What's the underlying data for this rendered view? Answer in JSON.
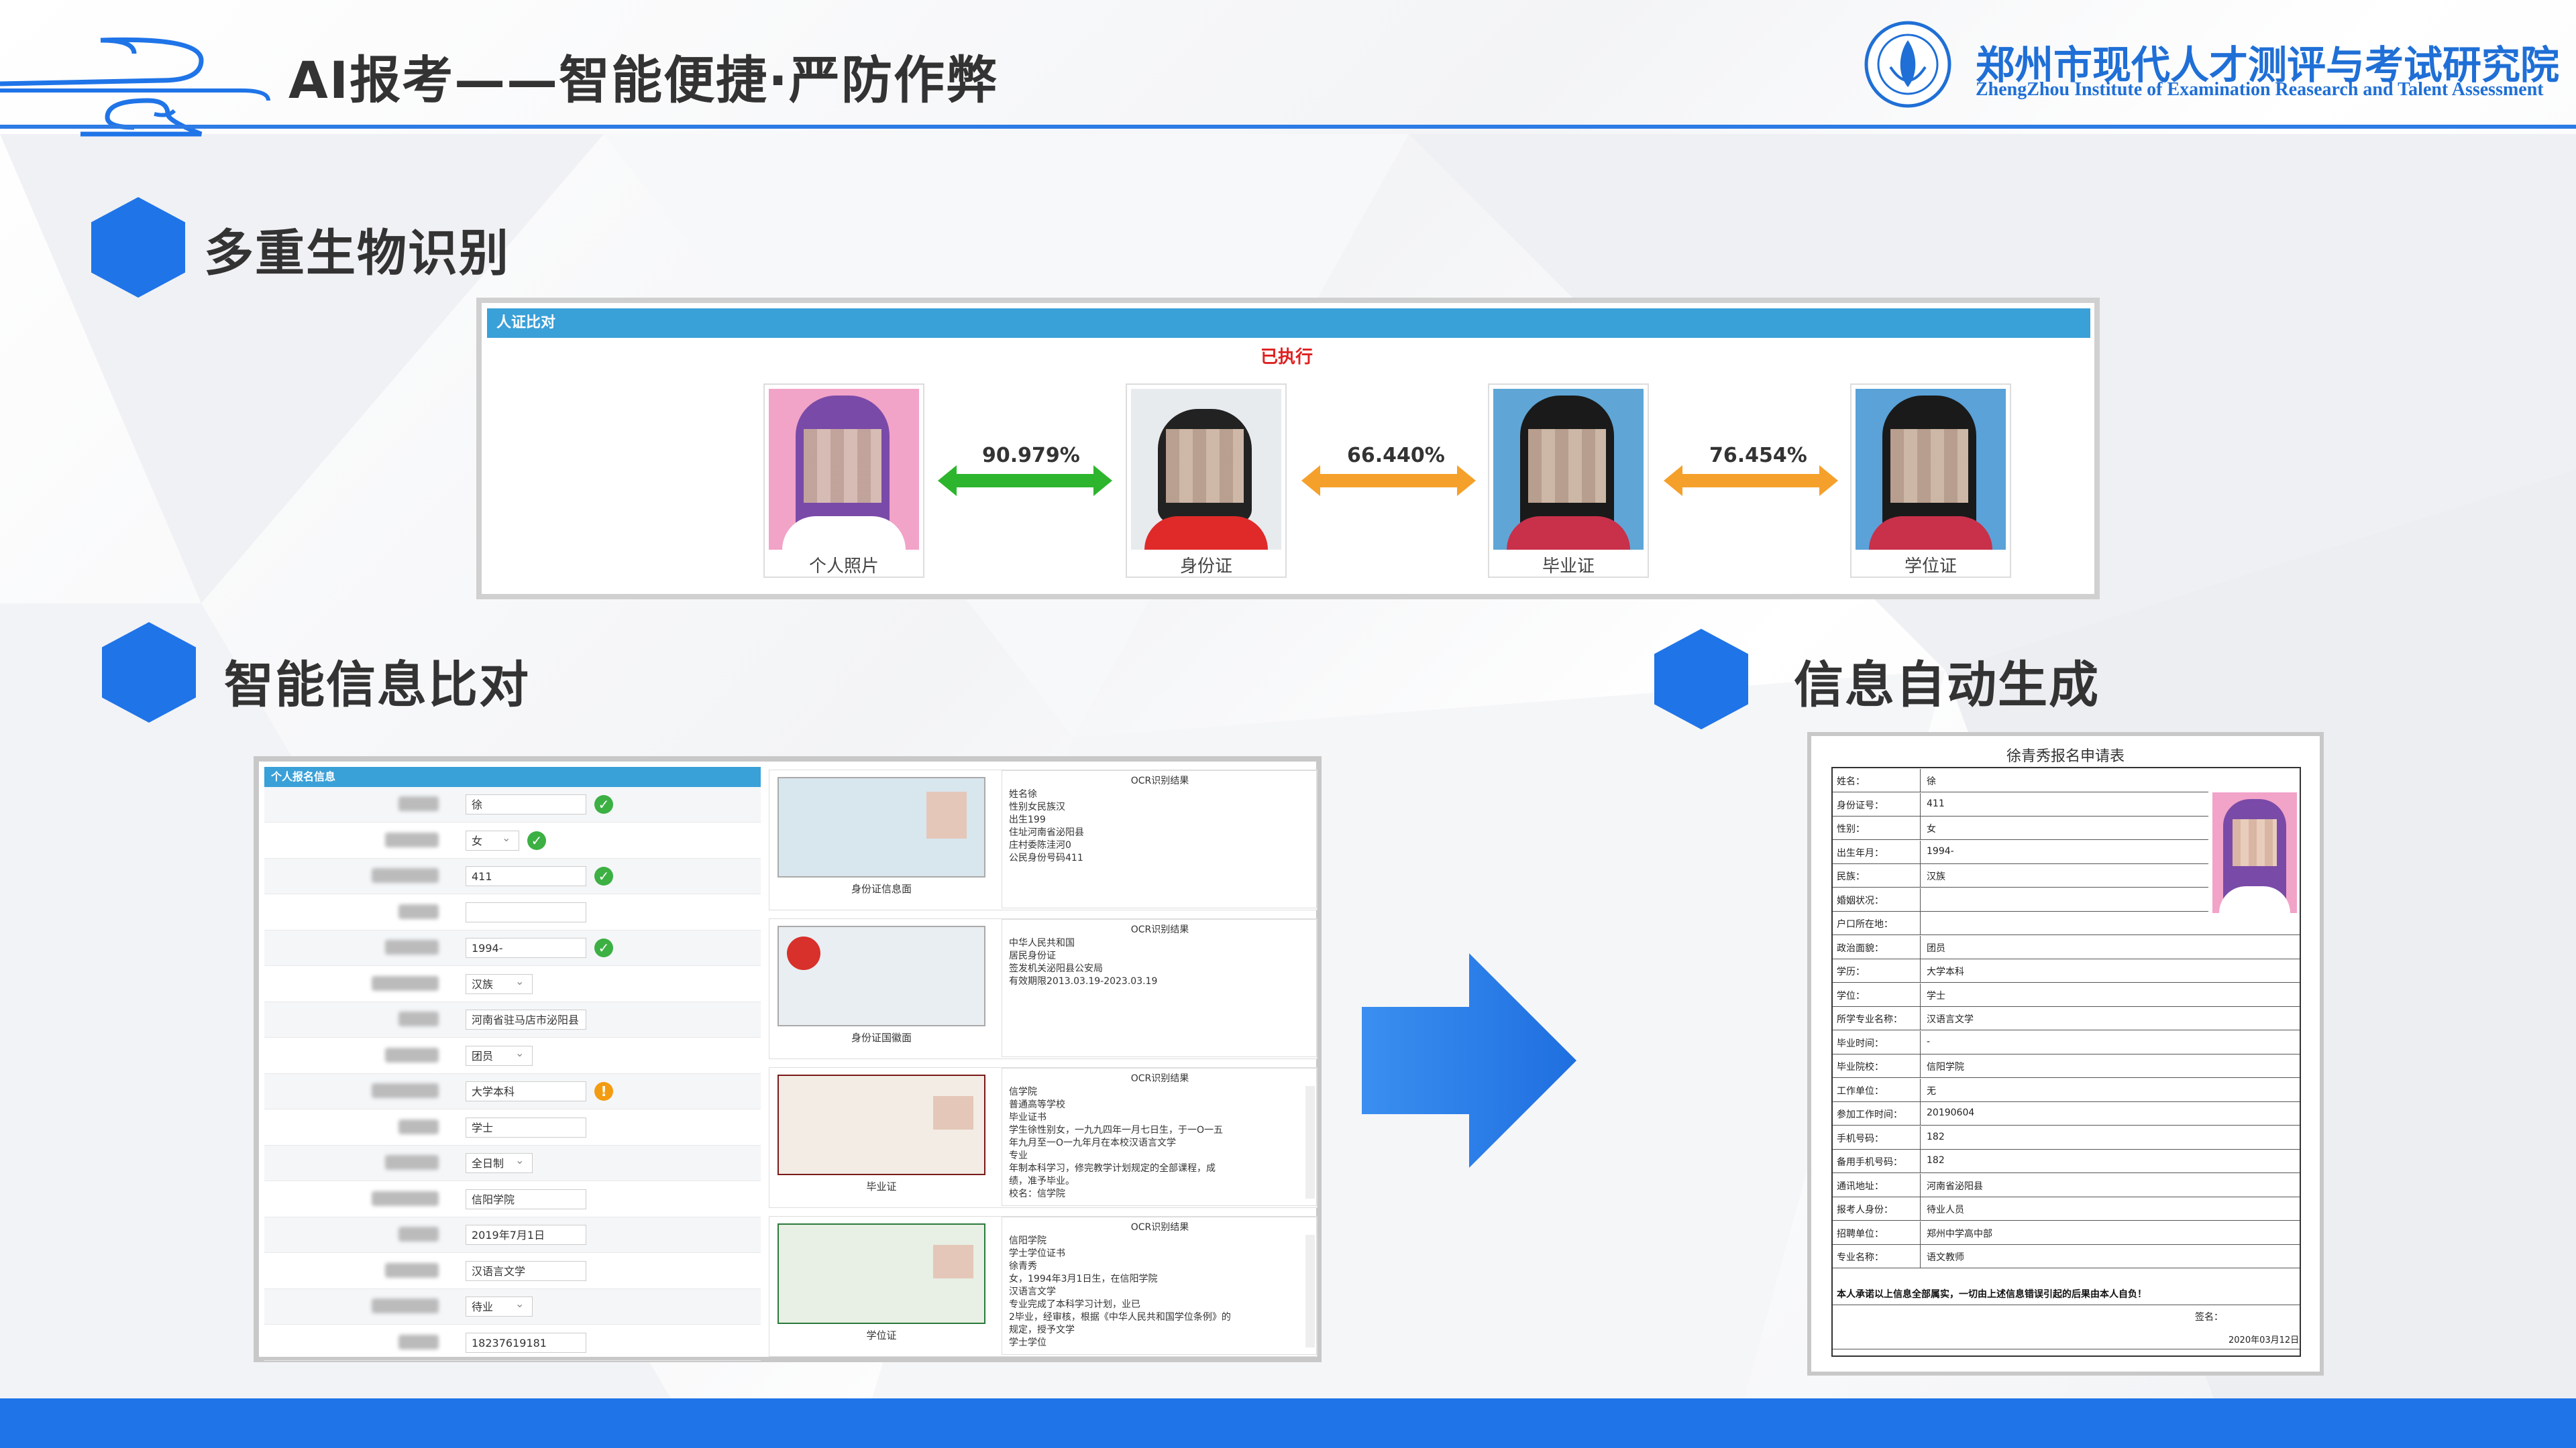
{
  "header": {
    "title": "AI报考——智能便捷·严防作弊",
    "org_cn": "郑州市现代人才测评与考试研究院",
    "org_en": "ZhengZhou Institute of Examination Reasearch and Talent Assessment"
  },
  "sections": {
    "biometric": "多重生物识别",
    "info_compare": "智能信息比对",
    "auto_generate": "信息自动生成"
  },
  "face_compare": {
    "panel_title": "人证比对",
    "status": "已执行",
    "photos": [
      {
        "caption": "个人照片"
      },
      {
        "caption": "身份证"
      },
      {
        "caption": "毕业证"
      },
      {
        "caption": "学位证"
      }
    ],
    "scores": [
      "90.979%",
      "66.440%",
      "76.454%"
    ],
    "arrow_colors": [
      "#2db52d",
      "#f5a02a",
      "#f5a02a"
    ]
  },
  "registration": {
    "panel_title": "个人报名信息",
    "fields": [
      {
        "value": "徐",
        "status": "ok"
      },
      {
        "value": "女",
        "status": "ok",
        "select": true
      },
      {
        "value": "411",
        "status": "ok"
      },
      {
        "value": "",
        "status": ""
      },
      {
        "value": "1994-",
        "status": "ok"
      },
      {
        "value": "汉族",
        "status": "",
        "select": true
      },
      {
        "value": "河南省驻马店市泌阳县",
        "status": ""
      },
      {
        "value": "团员",
        "status": "",
        "select": true
      },
      {
        "value": "大学本科",
        "status": "warn"
      },
      {
        "value": "学士",
        "status": ""
      },
      {
        "value": "全日制",
        "status": "",
        "select": true
      },
      {
        "value": "信阳学院",
        "status": ""
      },
      {
        "value": "2019年7月1日",
        "status": ""
      },
      {
        "value": "汉语言文学",
        "status": ""
      },
      {
        "value": "待业",
        "status": "",
        "select": true
      },
      {
        "value": "18237619181",
        "status": ""
      }
    ],
    "documents": [
      {
        "caption": "身份证信息面",
        "ocr_header": "OCR识别结果",
        "ocr_text": "姓名徐\n性别女民族汉\n出生199\n住址河南省泌阳县\n庄村委陈洼河0\n公民身份号码411"
      },
      {
        "caption": "身份证国徽面",
        "ocr_header": "OCR识别结果",
        "ocr_text": "中华人民共和国\n居民身份证\n签发机关泌阳县公安局\n有效期限2013.03.19-2023.03.19"
      },
      {
        "caption": "毕业证",
        "ocr_header": "OCR识别结果",
        "ocr_text": "信学院\n普通高等学校\n毕业证书\n学生徐性别女，一九九四年一月七日生，于一O一五\n年九月至一O一九年月在本校汉语言文学\n专业\n年制本科学习，修完教学计划规定的全部课程，成\n绩，准予毕业。\n校名：信学院"
      },
      {
        "caption": "学位证",
        "ocr_header": "OCR识别结果",
        "ocr_text": "信阳学院\n学士学位证书\n徐青秀\n女，1994年3月1日生，在信阳学院\n汉语言文学\n专业完成了本科学习计划，业已\n2毕业，经审核，根据《中华人民共和国学位条例》的\n规定，授予文学\n学士学位"
      }
    ]
  },
  "generated_form": {
    "title": "徐青秀报名申请表",
    "rows": [
      {
        "label": "姓名：",
        "value": "徐"
      },
      {
        "label": "身份证号：",
        "value": "411"
      },
      {
        "label": "性别：",
        "value": "女"
      },
      {
        "label": "出生年月：",
        "value": "1994-"
      },
      {
        "label": "民族：",
        "value": "汉族"
      },
      {
        "label": "婚姻状况：",
        "value": ""
      },
      {
        "label": "户口所在地：",
        "value": ""
      },
      {
        "label": "政治面貌：",
        "value": "团员"
      },
      {
        "label": "学历：",
        "value": "大学本科"
      },
      {
        "label": "学位：",
        "value": "学士"
      },
      {
        "label": "所学专业名称：",
        "value": "汉语言文学"
      },
      {
        "label": "毕业时间：",
        "value": "-"
      },
      {
        "label": "毕业院校：",
        "value": "信阳学院"
      },
      {
        "label": "工作单位：",
        "value": "无"
      },
      {
        "label": "参加工作时间：",
        "value": "20190604"
      },
      {
        "label": "手机号码：",
        "value": "182"
      },
      {
        "label": "备用手机号码：",
        "value": "182"
      },
      {
        "label": "通讯地址：",
        "value": "河南省泌阳县"
      },
      {
        "label": "报考人身份：",
        "value": "待业人员"
      },
      {
        "label": "招聘单位：",
        "value": "郑州中学高中部"
      },
      {
        "label": "专业名称：",
        "value": "语文教师"
      }
    ],
    "pledge": "本人承诺以上信息全部属实，一切由上述信息错误引起的后果由本人自负！",
    "sign_label": "签名：",
    "date": "2020年03月12日"
  },
  "colors": {
    "accent": "#1f74e8",
    "header_line": "#2d7be5",
    "panel_bar": "#3aa0d8"
  }
}
